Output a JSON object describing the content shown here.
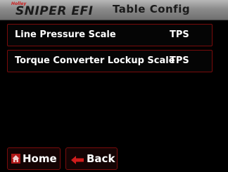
{
  "header": {
    "logo_badge": "Holley",
    "logo_text": "SNIPER EFI",
    "title": "Table Config"
  },
  "rows": [
    {
      "label": "Line Pressure Scale",
      "value": "TPS"
    },
    {
      "label": "Torque Converter Lockup Scale",
      "value": "TPS"
    }
  ],
  "nav": {
    "home_label": "Home",
    "back_label": "Back"
  },
  "colors": {
    "accent": "#cc1c1c",
    "row_border": "#7a0c0c",
    "background": "#000000"
  },
  "icons": {
    "home": "home-icon",
    "back": "back-arrow-icon"
  }
}
